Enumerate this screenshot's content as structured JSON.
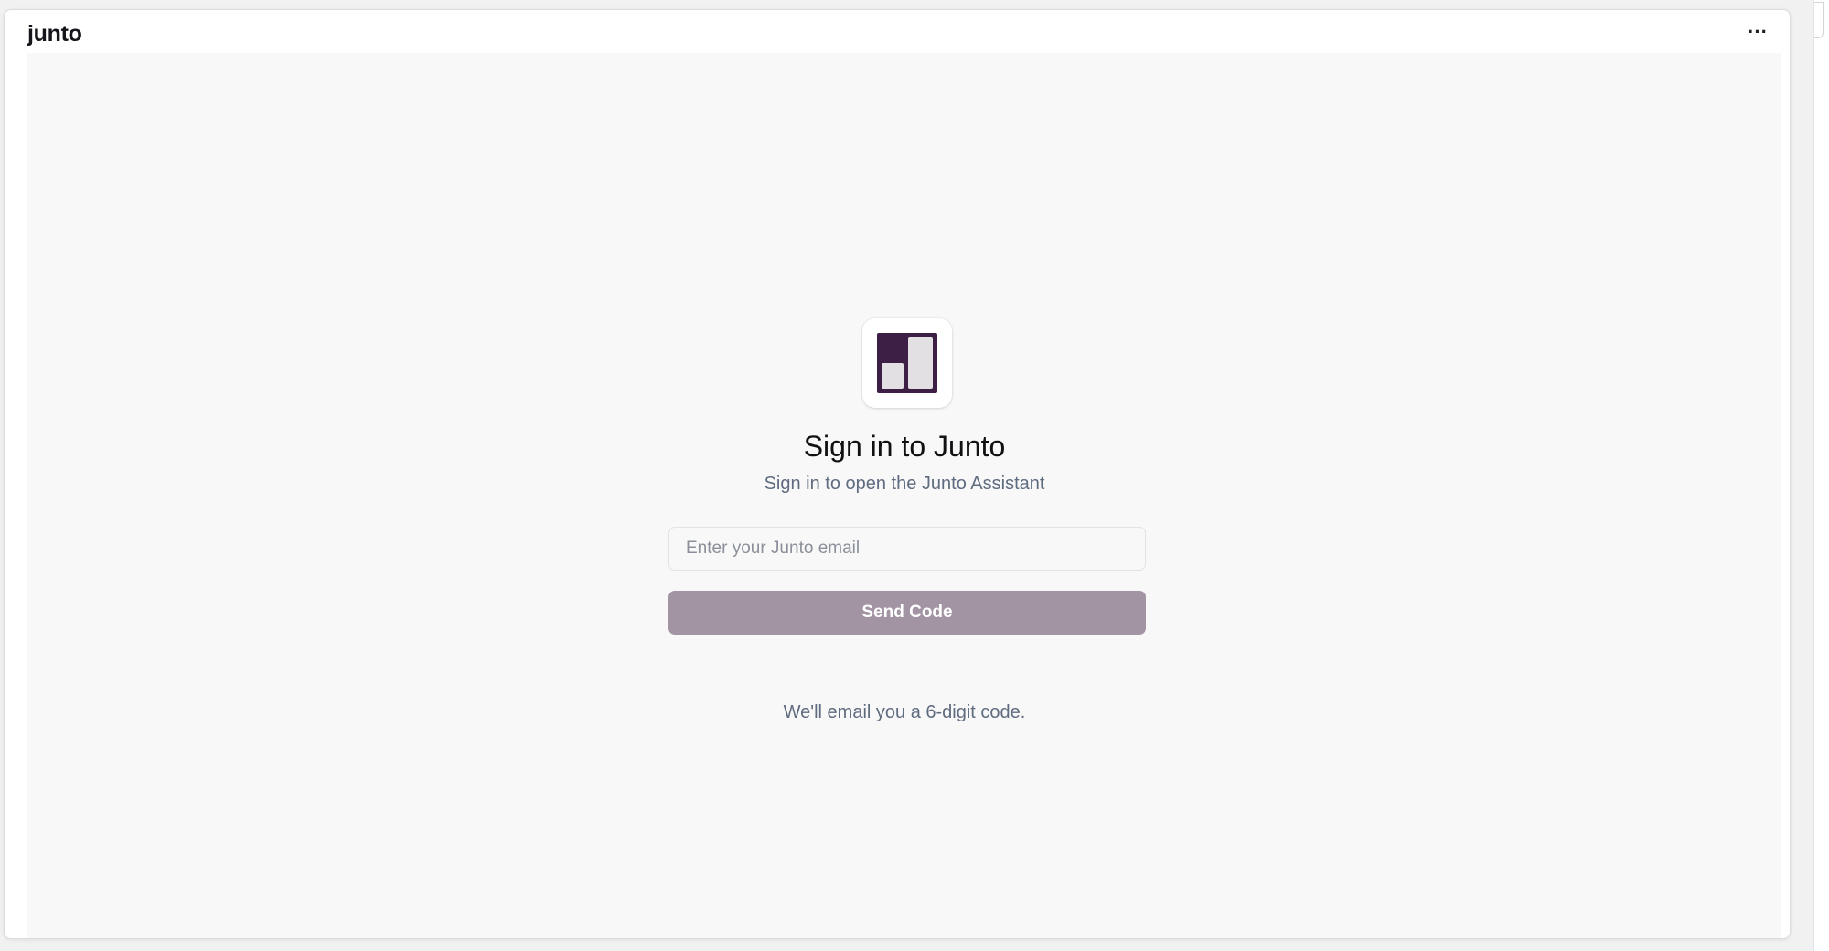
{
  "app": {
    "title": "junto",
    "more_icon": "more-horizontal-icon",
    "more_label": "···"
  },
  "signin": {
    "logo_icon": "junto-logo-icon",
    "logo_color": "#3d1f45",
    "heading": "Sign in to Junto",
    "subheading": "Sign in to open the Junto Assistant",
    "email_placeholder": "Enter your Junto email",
    "email_value": "",
    "send_label": "Send Code",
    "send_color": "#a394a4",
    "hint": "We'll email you a 6-digit code."
  }
}
